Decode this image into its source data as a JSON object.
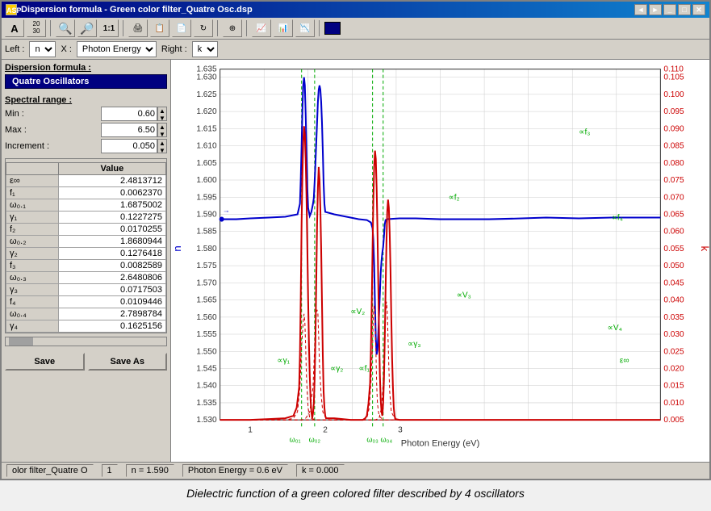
{
  "window": {
    "title": "Dispersion formula - Green color filter_Quatre Osc.dsp",
    "icon": "ASP"
  },
  "toolbar": {
    "buttons": [
      "A",
      "20/30",
      "zoom-out",
      "zoom-in",
      "1:1",
      "print",
      "copy1",
      "copy2",
      "refresh",
      "crosshair",
      "chart1",
      "chart2",
      "chart3"
    ],
    "color_label": "color-box"
  },
  "second_bar": {
    "left_label": "Left :",
    "left_value": "n",
    "x_label": "X :",
    "x_value": "Photon Energy",
    "right_label": "Right :",
    "right_value": "k"
  },
  "left_panel": {
    "dispersion_label": "Dispersion formula :",
    "formula_type": "Quatre Oscillators",
    "spectral_range_label": "Spectral range :",
    "min_label": "Min :",
    "min_value": "0.60",
    "max_label": "Max :",
    "max_value": "6.50",
    "increment_label": "Increment :",
    "increment_value": "0.050",
    "table_header": "Value",
    "params": [
      {
        "name": "ε∞",
        "value": "2.4813712"
      },
      {
        "name": "f₁",
        "value": "0.0062370"
      },
      {
        "name": "ω₀.₁",
        "value": "1.6875002"
      },
      {
        "name": "γ₁",
        "value": "0.1227275"
      },
      {
        "name": "f₂",
        "value": "0.0170255"
      },
      {
        "name": "ω₀.₂",
        "value": "1.8680944"
      },
      {
        "name": "γ₂",
        "value": "0.1276418"
      },
      {
        "name": "f₃",
        "value": "0.0082589"
      },
      {
        "name": "ω₀.₃",
        "value": "2.6480806"
      },
      {
        "name": "γ₃",
        "value": "0.0717503"
      },
      {
        "name": "f₄",
        "value": "0.0109446"
      },
      {
        "name": "ω₀.₄",
        "value": "2.7898784"
      },
      {
        "name": "γ₄",
        "value": "0.1625156"
      }
    ],
    "save_label": "Save",
    "save_as_label": "Save As"
  },
  "chart": {
    "x_axis_label": "Photon Energy (eV)",
    "y_left_label": "n",
    "y_left_min": "1.530",
    "y_left_max": "1.635",
    "y_right_label": "k",
    "y_right_min": "0.005",
    "y_right_max": "0.110",
    "annotations": [
      "∝f₂",
      "∝f₃",
      "∝f₄",
      "∝f₁",
      "∝V₂",
      "∝V₃",
      "∝V₄",
      "∝γ₁",
      "∝γ₂",
      "∝γ₃",
      "ε∞"
    ],
    "omega_labels": [
      "ω₀₁",
      "ω₀₂",
      "ω₀₃",
      "ω₀₄"
    ]
  },
  "status_bar": {
    "file": "olor filter_Quatre O",
    "value1": "1",
    "n_value": "n = 1.590",
    "photon_energy": "Photon Energy = 0.6 eV",
    "k_value": "k = 0.000"
  },
  "caption": "Dielectric function of a green colored filter described by 4 oscillators"
}
